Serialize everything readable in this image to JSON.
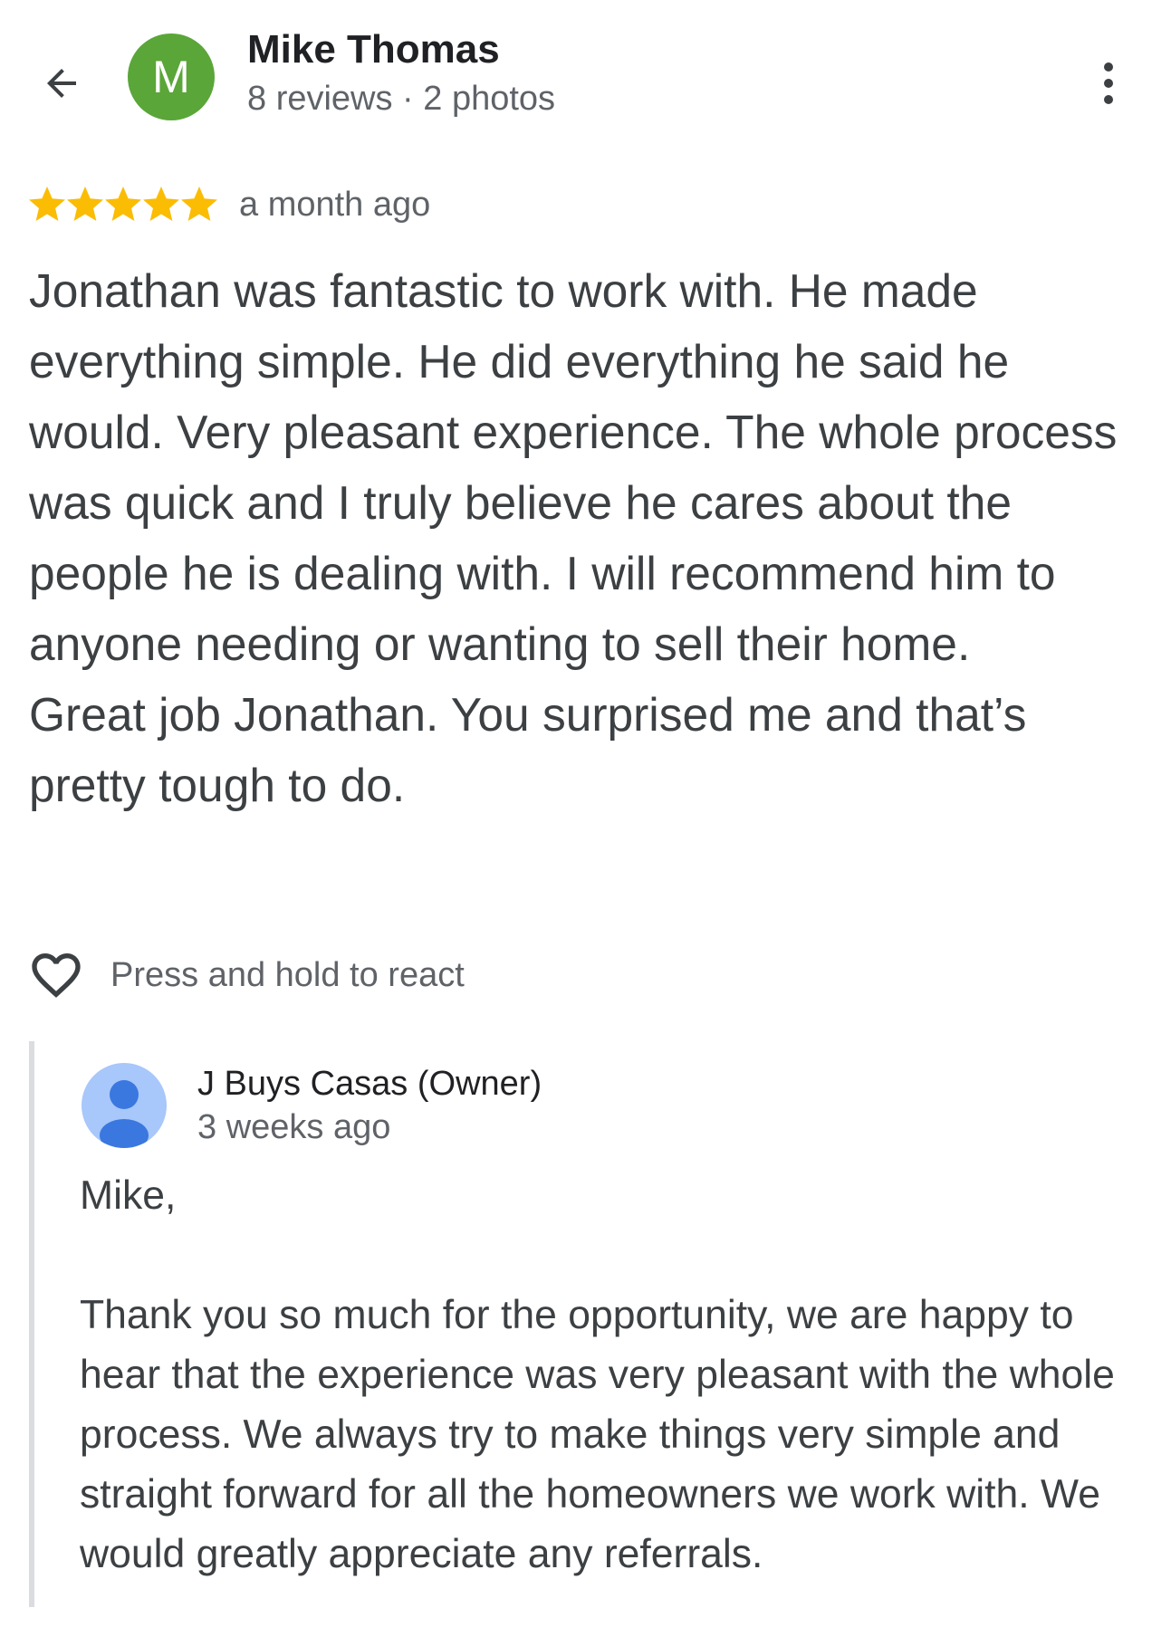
{
  "header": {
    "back_icon": "arrow-back-icon",
    "avatar_letter": "M",
    "avatar_color": "#5aa639",
    "author_name": "Mike Thomas",
    "author_meta": "8 reviews · 2 photos",
    "more_icon": "more-vertical-icon"
  },
  "review": {
    "rating": 5,
    "rating_max": 5,
    "star_color": "#fbbc04",
    "time": "a month ago",
    "text": "Jonathan was fantastic to work with. He made everything simple. He did everything he said he would. Very pleasant experience. The whole process was quick and I truly believe he cares about the people he is dealing with. I will recommend him to anyone needing or wanting to sell their home.\nGreat job Jonathan. You surprised me and that’s pretty tough to do."
  },
  "reaction": {
    "icon": "heart-outline-icon",
    "label": "Press and hold to react"
  },
  "owner_reply": {
    "avatar_icon": "person-avatar-icon",
    "name": "J Buys Casas (Owner)",
    "time": "3 weeks ago",
    "text": "Mike,\n\nThank you so much for the opportunity, we are happy to hear that the experience was very pleasant with the whole process. We always try to make things very simple and straight forward for all the homeowners we work with. We would greatly appreciate any referrals."
  }
}
